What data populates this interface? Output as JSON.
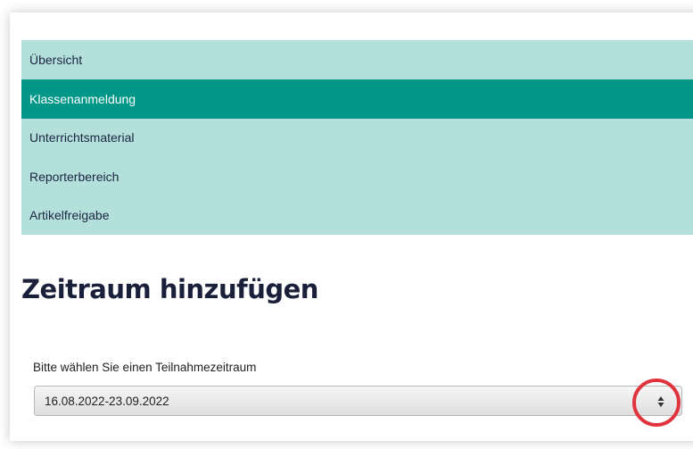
{
  "nav": {
    "items": [
      {
        "label": "Übersicht",
        "active": false
      },
      {
        "label": "Klassenanmeldung",
        "active": true
      },
      {
        "label": "Unterrichtsmaterial",
        "active": false
      },
      {
        "label": "Reporterbereich",
        "active": false
      },
      {
        "label": "Artikelfreigabe",
        "active": false
      }
    ]
  },
  "page": {
    "title": "Zeitraum hinzufügen"
  },
  "period": {
    "label": "Bitte wählen Sie einen Teilnahmezeitraum",
    "selected": "16.08.2022-23.09.2022"
  },
  "colors": {
    "nav_background": "#b4e0dc",
    "nav_active": "#009688",
    "highlight": "#e0343d"
  }
}
